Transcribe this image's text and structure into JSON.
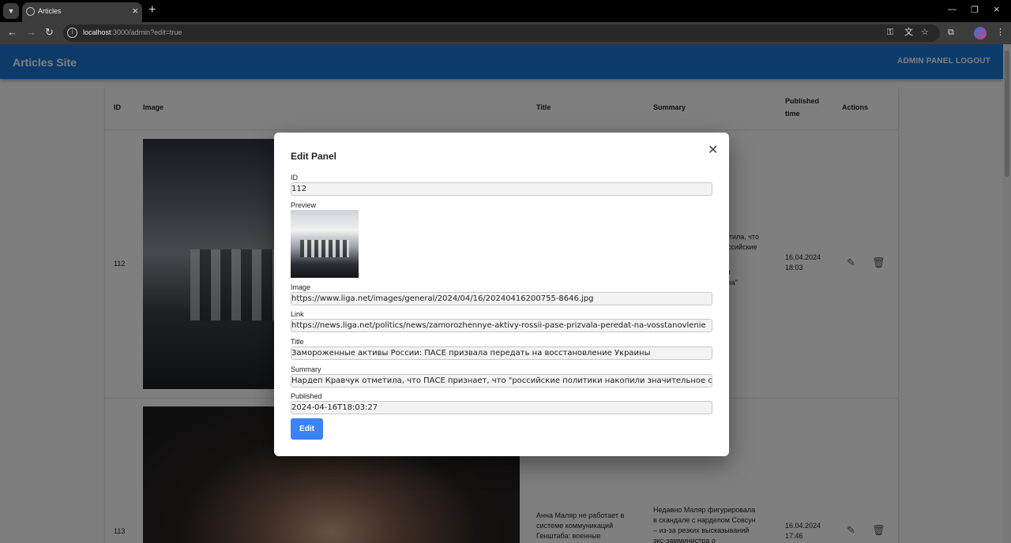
{
  "browser": {
    "tab_title": "Articles",
    "url_host": "localhost",
    "url_rest": ":3000/admin?edit=true"
  },
  "app": {
    "brand": "Articles Site",
    "nav": [
      "ADMIN PANEL",
      "LOGOUT"
    ]
  },
  "table": {
    "headers": [
      "ID",
      "Image",
      "Title",
      "Summary",
      "Published time",
      "Actions"
    ],
    "rows": [
      {
        "id": "112",
        "summary_visible": [
          "отметила, что",
          "российские",
          "ние",
          "ным",
          "утина\""
        ],
        "published": [
          "16.04.2024",
          "18:03"
        ]
      },
      {
        "id": "113",
        "title": [
          "Анна Маляр не работает в",
          "системе коммуникаций",
          "Генштаба: военные"
        ],
        "summary": [
          "Недавно Маляр фигурировала",
          "в скандале с нардепом Совсун",
          "– из-за резких высказываний",
          "экс-замминистра о"
        ],
        "published": [
          "16.04.2024",
          "17:46"
        ]
      }
    ]
  },
  "modal": {
    "title": "Edit Panel",
    "fields": {
      "id_label": "ID",
      "id_value": "112",
      "preview_label": "Preview",
      "image_label": "Image",
      "image_value": "https://www.liga.net/images/general/2024/04/16/20240416200755-8646.jpg",
      "link_label": "Link",
      "link_value": "https://news.liga.net/politics/news/zamorozhennye-aktivy-rossii-pase-prizvala-peredat-na-vosstanovlenie",
      "title_label": "Title",
      "title_value": "Замороженные активы России: ПАСЕ призвала передать на восстановление Украины",
      "summary_label": "Summary",
      "summary_value": "Нардеп Кравчук отметила, что ПАСЕ признает, что \"российские политики накопили значительное сос",
      "published_label": "Published",
      "published_value": "2024-04-16T18:03:27"
    },
    "edit_label": "Edit"
  }
}
